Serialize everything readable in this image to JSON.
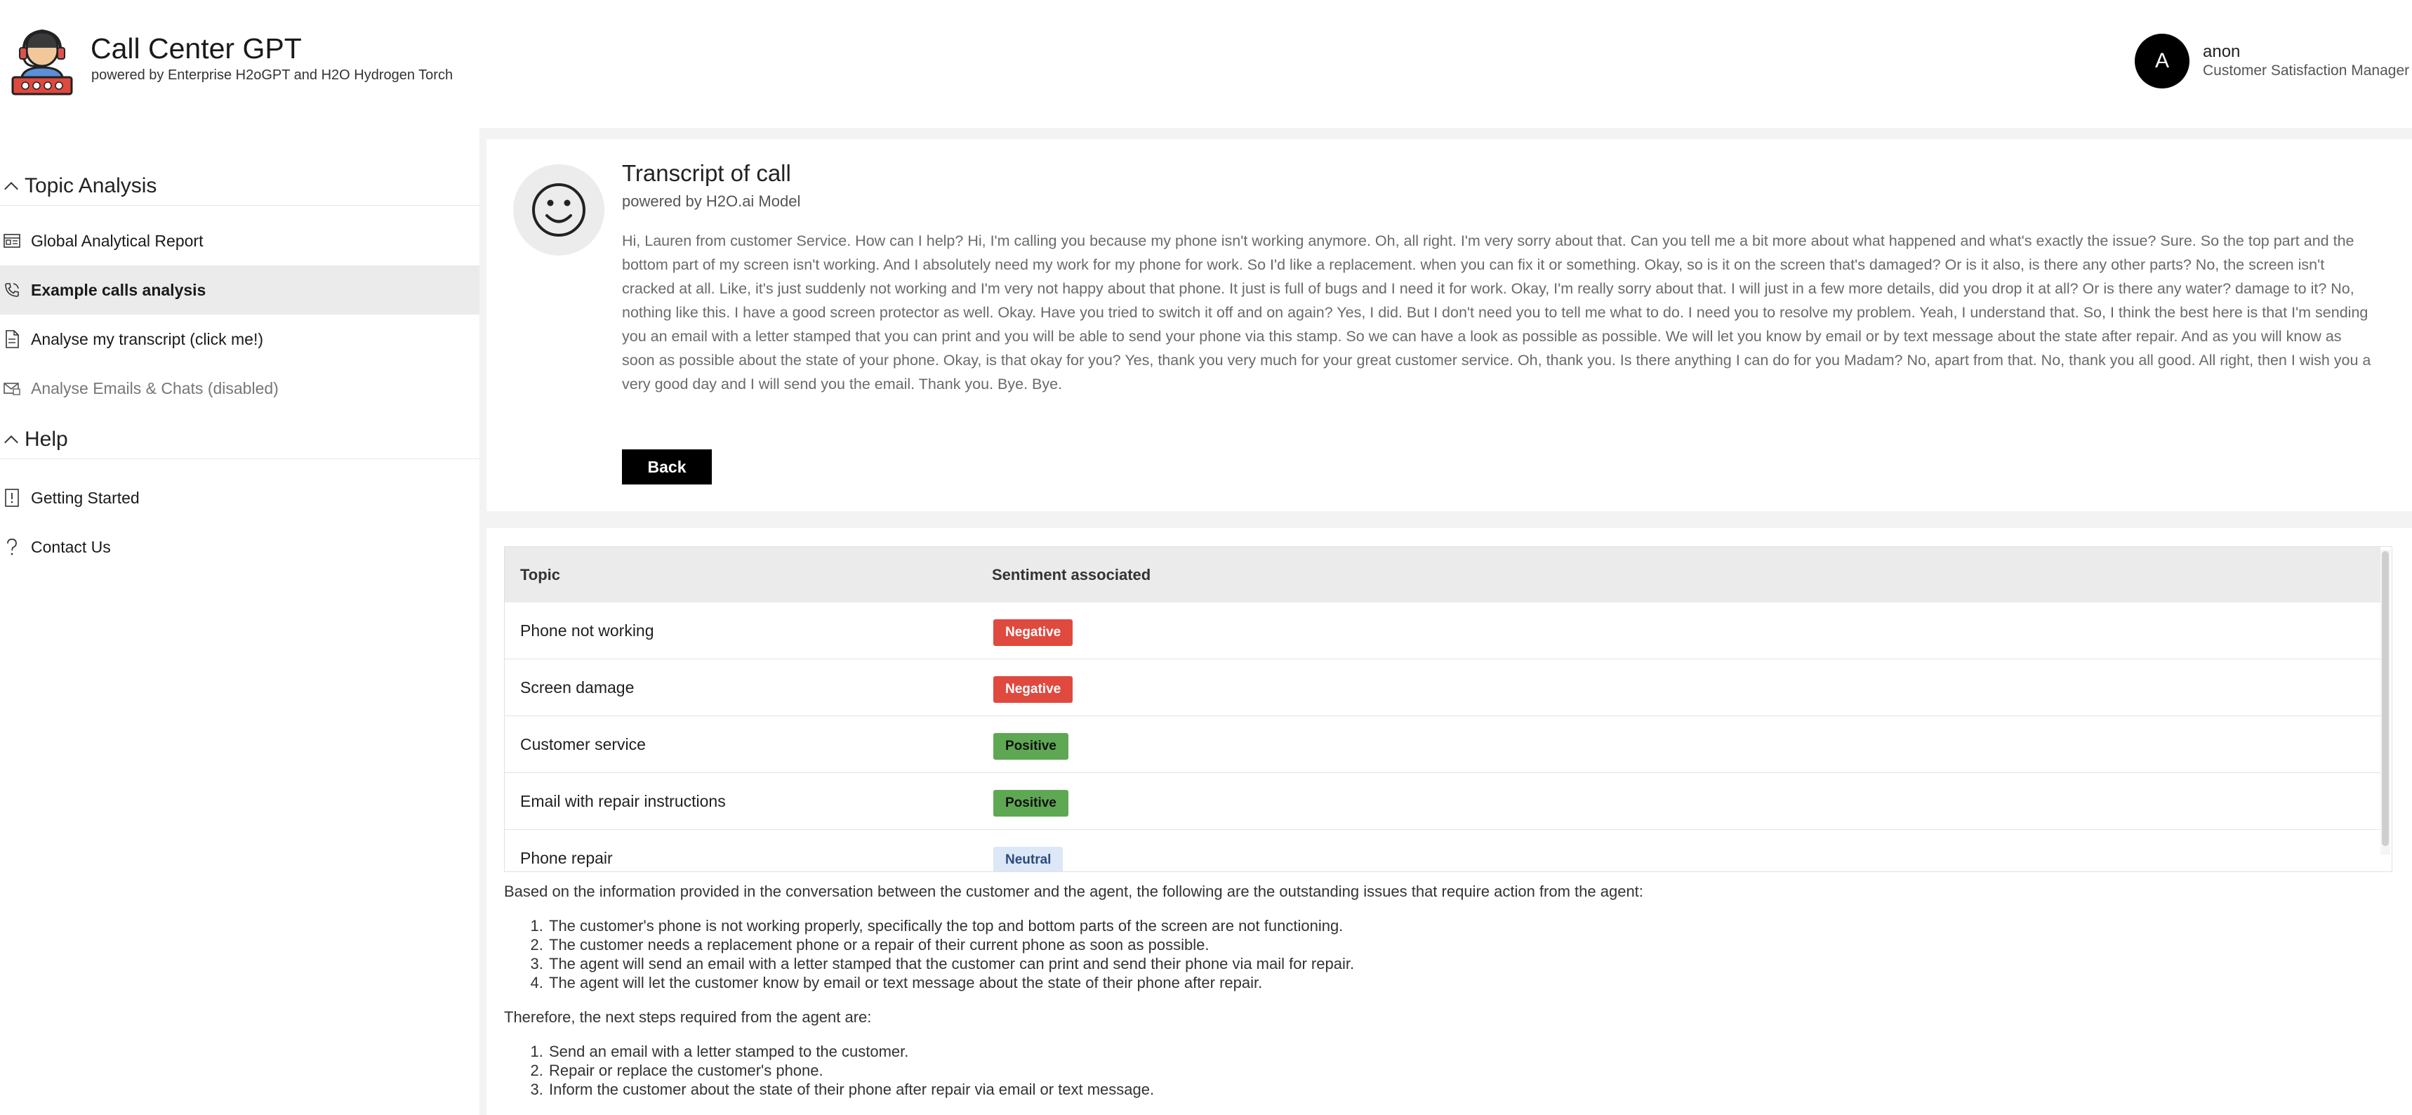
{
  "header": {
    "title": "Call Center GPT",
    "subtitle": "powered by Enterprise H2oGPT and H2O Hydrogen Torch",
    "user": {
      "initial": "A",
      "name": "anon",
      "role": "Customer Satisfaction Manager"
    }
  },
  "sidebar": {
    "sections": [
      {
        "title": "Topic Analysis"
      },
      {
        "title": "Help"
      }
    ],
    "items": [
      {
        "label": "Global Analytical Report",
        "icon": "report-icon"
      },
      {
        "label": "Example calls analysis",
        "icon": "phone-icon"
      },
      {
        "label": "Analyse my transcript (click me!)",
        "icon": "document-icon"
      },
      {
        "label": "Analyse Emails & Chats (disabled)",
        "icon": "email-icon"
      },
      {
        "label": "Getting Started",
        "icon": "book-icon"
      },
      {
        "label": "Contact Us",
        "icon": "question-icon"
      }
    ]
  },
  "transcript": {
    "title": "Transcript of call",
    "subtitle": "powered by H2O.ai Model",
    "text": "Hi, Lauren from customer Service. How can I help? Hi, I'm calling you because my phone isn't working anymore. Oh, all right. I'm very sorry about that. Can you tell me a bit more about what happened and what's exactly the issue? Sure. So the top part and the bottom part of my screen isn't working. And I absolutely need my work for my phone for work. So I'd like a replacement. when you can fix it or something. Okay, so is it on the screen that's damaged? Or is it also, is there any other parts? No, the screen isn't cracked at all. Like, it's just suddenly not working and I'm very not happy about that phone. It just is full of bugs and I need it for work. Okay, I'm really sorry about that. I will just in a few more details, did you drop it at all? Or is there any water? damage to it? No, nothing like this. I have a good screen protector as well. Okay. Have you tried to switch it off and on again? Yes, I did. But I don't need you to tell me what to do. I need you to resolve my problem. Yeah, I understand that. So, I think the best here is that I'm sending you an email with a letter stamped that you can print and you will be able to send your phone via this stamp. So we can have a look as possible as possible. We will let you know by email or by text message about the state after repair. And as you will know as soon as possible about the state of your phone. Okay, is that okay for you? Yes, thank you very much for your great customer service. Oh, thank you. Is there anything I can do for you Madam? No, apart from that. No, thank you all good. All right, then I wish you a very good day and I will send you the email. Thank you. Bye. Bye.",
    "back_label": "Back"
  },
  "topics_table": {
    "headers": [
      "Topic",
      "Sentiment associated"
    ],
    "rows": [
      {
        "topic": "Phone not working",
        "sentiment": "Negative",
        "kind": "negative"
      },
      {
        "topic": "Screen damage",
        "sentiment": "Negative",
        "kind": "negative"
      },
      {
        "topic": "Customer service",
        "sentiment": "Positive",
        "kind": "positive"
      },
      {
        "topic": "Email with repair instructions",
        "sentiment": "Positive",
        "kind": "positive"
      },
      {
        "topic": "Phone repair",
        "sentiment": "Neutral",
        "kind": "neutral"
      }
    ]
  },
  "analysis": {
    "intro": "Based on the information provided in the conversation between the customer and the agent, the following are the outstanding issues that require action from the agent:",
    "issues": [
      "The customer's phone is not working properly, specifically the top and bottom parts of the screen are not functioning.",
      "The customer needs a replacement phone or a repair of their current phone as soon as possible.",
      "The agent will send an email with a letter stamped that the customer can print and send their phone via mail for repair.",
      "The agent will let the customer know by email or text message about the state of their phone after repair."
    ],
    "next_intro": "Therefore, the next steps required from the agent are:",
    "steps": [
      "Send an email with a letter stamped to the customer.",
      "Repair or replace the customer's phone.",
      "Inform the customer about the state of their phone after repair via email or text message."
    ]
  },
  "colors": {
    "negative": "#e0493e",
    "positive": "#5ea853",
    "neutral": "#dce7f7",
    "accent": "#000000"
  }
}
